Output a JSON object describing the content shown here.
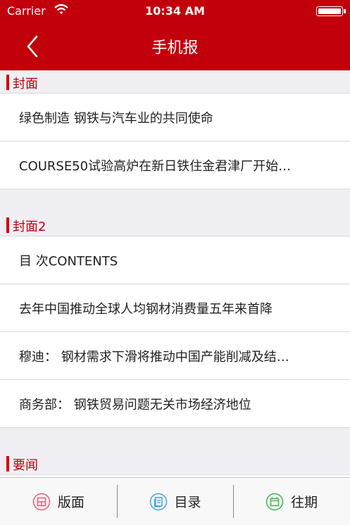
{
  "status_bar": {
    "carrier": "Carrier",
    "time": "10:34 AM"
  },
  "nav": {
    "title": "手机报"
  },
  "sections": [
    {
      "title": "封面",
      "items": [
        "绿色制造 钢铁与汽车业的共同使命",
        "COURSE50试验高炉在新日铁住金君津厂开始…"
      ]
    },
    {
      "title": "封面2",
      "items": [
        "目  次CONTENTS",
        "去年中国推动全球人均钢材消费量五年来首降",
        "穆迪： 钢材需求下滑将推动中国产能削减及结…",
        "商务部： 钢铁贸易问题无关市场经济地位"
      ]
    },
    {
      "title": "要闻",
      "items": []
    }
  ],
  "tabs": [
    {
      "label": "版面",
      "icon": "layout-icon",
      "color": "#e0607a"
    },
    {
      "label": "目录",
      "icon": "catalog-icon",
      "color": "#4aa3d8"
    },
    {
      "label": "往期",
      "icon": "calendar-icon",
      "color": "#4cb05a"
    }
  ],
  "colors": {
    "brand": "#c2000b",
    "accent_bar": "#d9000d"
  }
}
